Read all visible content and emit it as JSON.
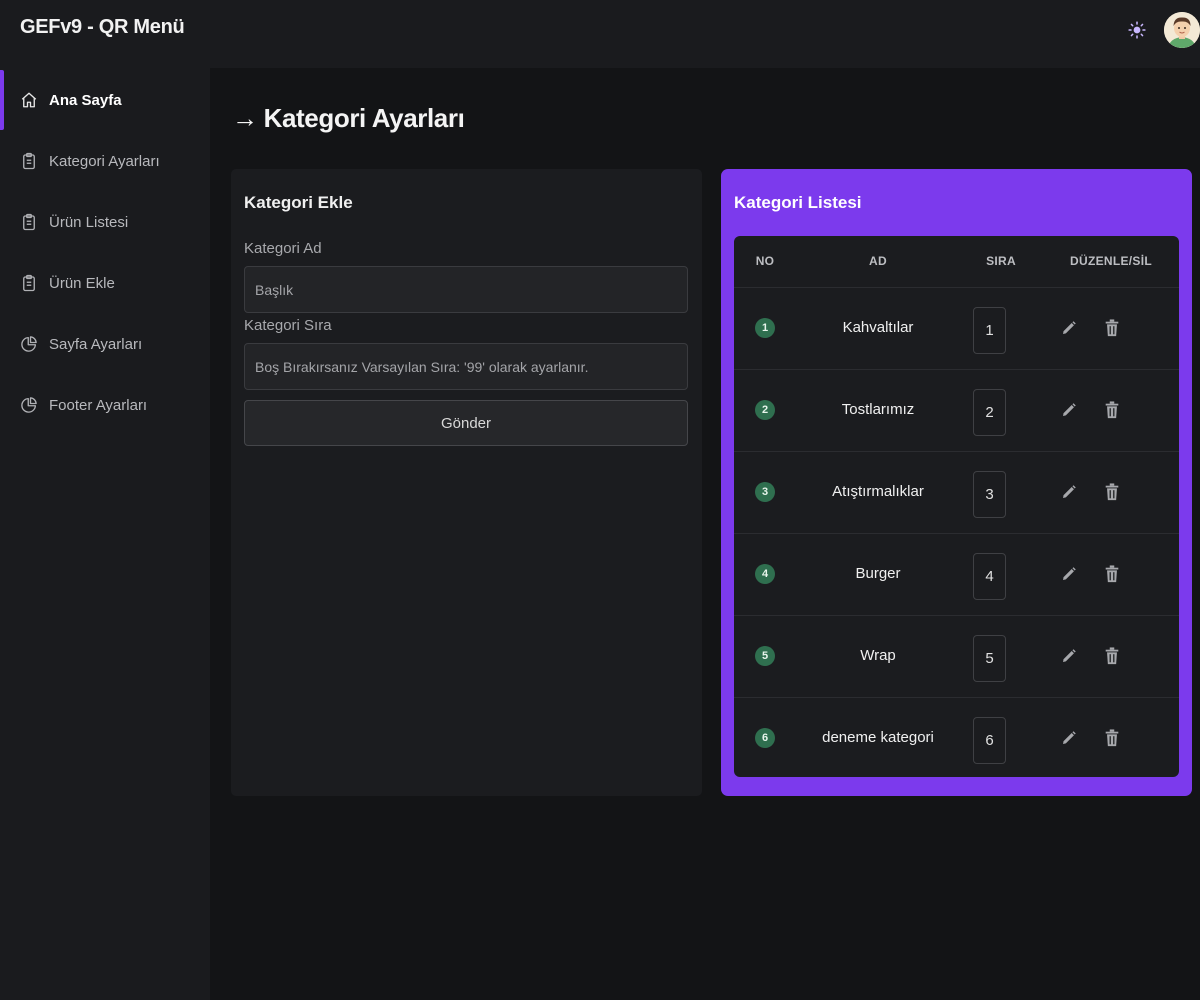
{
  "app": {
    "title": "GEFv9 - QR Menü"
  },
  "header": {
    "theme_icon": "sun-icon",
    "avatar_icon": "user-avatar"
  },
  "sidebar": {
    "items": [
      {
        "label": "Ana Sayfa",
        "icon": "home-icon",
        "active": true
      },
      {
        "label": "Kategori Ayarları",
        "icon": "clipboard-icon",
        "active": false
      },
      {
        "label": "Ürün Listesi",
        "icon": "clipboard-icon",
        "active": false
      },
      {
        "label": "Ürün Ekle",
        "icon": "clipboard-icon",
        "active": false
      },
      {
        "label": "Sayfa Ayarları",
        "icon": "pie-chart-icon",
        "active": false
      },
      {
        "label": "Footer Ayarları",
        "icon": "pie-chart-icon",
        "active": false
      }
    ]
  },
  "page": {
    "arrow": "→",
    "title": "Kategori Ayarları"
  },
  "form": {
    "title": "Kategori Ekle",
    "name_label": "Kategori Ad",
    "name_placeholder": "Başlık",
    "order_label": "Kategori Sıra",
    "order_placeholder": "Boş Bırakırsanız Varsayılan Sıra: '99' olarak ayarlanır.",
    "submit_label": "Gönder"
  },
  "list": {
    "title": "Kategori Listesi",
    "columns": [
      "NO",
      "AD",
      "SIRA",
      "DÜZENLE/SİL"
    ],
    "rows": [
      {
        "no": "1",
        "name": "Kahvaltılar",
        "order": "1"
      },
      {
        "no": "2",
        "name": "Tostlarımız",
        "order": "2"
      },
      {
        "no": "3",
        "name": "Atıştırmalıklar",
        "order": "3"
      },
      {
        "no": "4",
        "name": "Burger",
        "order": "4"
      },
      {
        "no": "5",
        "name": "Wrap",
        "order": "5"
      },
      {
        "no": "6",
        "name": "deneme kategori",
        "order": "6"
      }
    ]
  },
  "colors": {
    "accent": "#7c3aed",
    "badge": "#2f6f4f",
    "background": "#131416",
    "panel": "#1b1c1f"
  }
}
